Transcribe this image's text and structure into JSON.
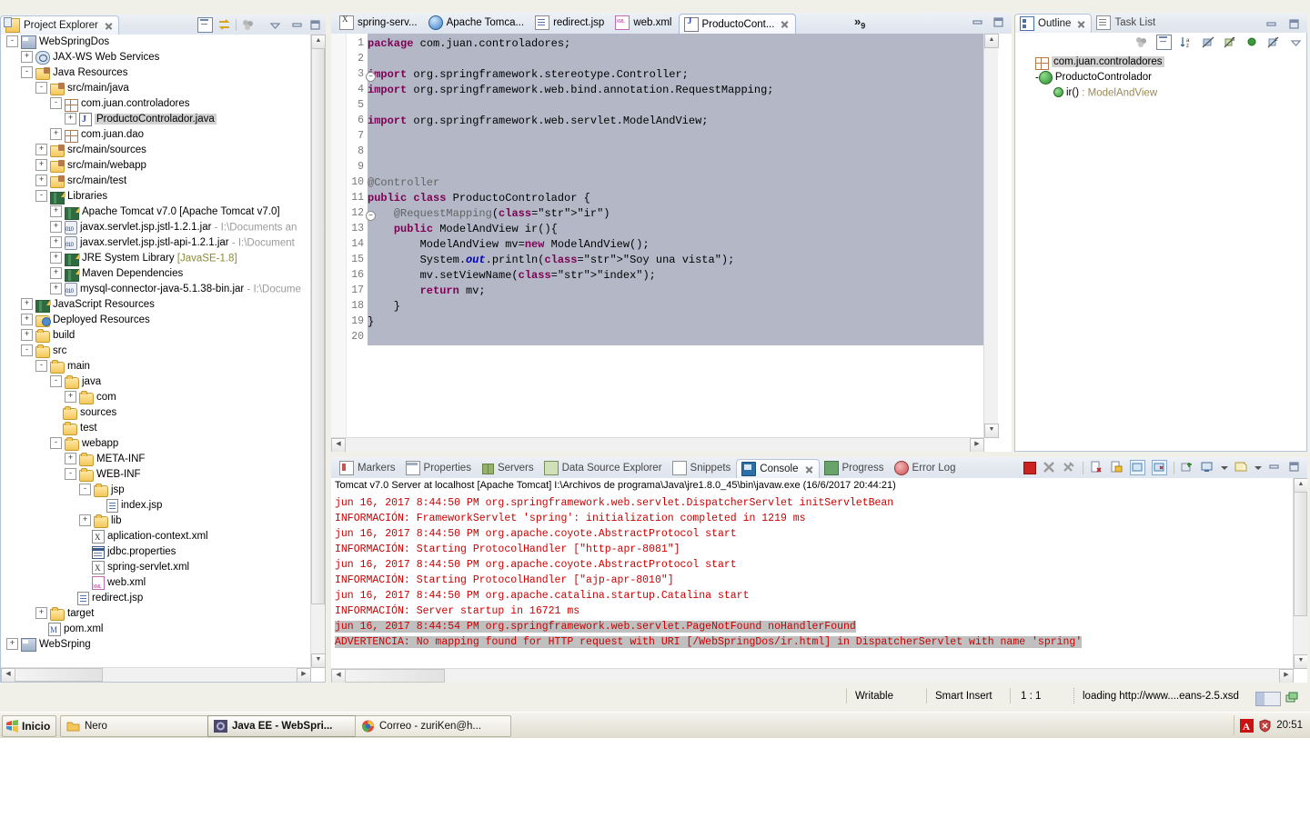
{
  "project_explorer": {
    "title": "Project Explorer",
    "toolbar_icons": [
      "collapse-all-icon",
      "link-with-editor-icon",
      "view-menu-dots-icon",
      "view-menu-chevron-icon",
      "minimize-icon",
      "maximize-icon"
    ],
    "tree": [
      {
        "depth": 0,
        "expander": "-",
        "icon": "project-icon",
        "label": "WebSpringDos"
      },
      {
        "depth": 1,
        "expander": "+",
        "icon": "webservices-icon",
        "label": "JAX-WS Web Services"
      },
      {
        "depth": 1,
        "expander": "-",
        "icon": "java-resources-icon",
        "label": "Java Resources"
      },
      {
        "depth": 2,
        "expander": "-",
        "icon": "source-folder-icon",
        "label": "src/main/java"
      },
      {
        "depth": 3,
        "expander": "-",
        "icon": "package-icon",
        "label": "com.juan.controladores"
      },
      {
        "depth": 4,
        "expander": "+",
        "icon": "java-file-icon",
        "label": "ProductoControlador.java",
        "selected": true
      },
      {
        "depth": 3,
        "expander": "+",
        "icon": "package-icon",
        "label": "com.juan.dao"
      },
      {
        "depth": 2,
        "expander": "+",
        "icon": "source-folder-icon",
        "label": "src/main/sources"
      },
      {
        "depth": 2,
        "expander": "+",
        "icon": "source-folder-icon",
        "label": "src/main/webapp"
      },
      {
        "depth": 2,
        "expander": "+",
        "icon": "source-folder-icon",
        "label": "src/main/test"
      },
      {
        "depth": 2,
        "expander": "-",
        "icon": "library-icon",
        "label": "Libraries"
      },
      {
        "depth": 3,
        "expander": "+",
        "icon": "library-icon",
        "label": "Apache Tomcat v7.0 [Apache Tomcat v7.0]"
      },
      {
        "depth": 3,
        "expander": "+",
        "icon": "jar-icon",
        "label": "javax.servlet.jsp.jstl-1.2.1.jar",
        "suffix": " - I:\\Documents an"
      },
      {
        "depth": 3,
        "expander": "+",
        "icon": "jar-icon",
        "label": "javax.servlet.jsp.jstl-api-1.2.1.jar",
        "suffix": " - I:\\Document"
      },
      {
        "depth": 3,
        "expander": "+",
        "icon": "library-icon",
        "label": "JRE System Library",
        "suffix": " [JavaSE-1.8]",
        "suffix_style": "green"
      },
      {
        "depth": 3,
        "expander": "+",
        "icon": "library-icon",
        "label": "Maven Dependencies"
      },
      {
        "depth": 3,
        "expander": "+",
        "icon": "jar-icon",
        "label": "mysql-connector-java-5.1.38-bin.jar",
        "suffix": " - I:\\Docume"
      },
      {
        "depth": 1,
        "expander": "+",
        "icon": "library-icon",
        "label": "JavaScript Resources"
      },
      {
        "depth": 1,
        "expander": "+",
        "icon": "deployed-resources-icon",
        "label": "Deployed Resources"
      },
      {
        "depth": 1,
        "expander": "+",
        "icon": "folder-icon",
        "label": "build"
      },
      {
        "depth": 1,
        "expander": "-",
        "icon": "folder-icon",
        "label": "src"
      },
      {
        "depth": 2,
        "expander": "-",
        "icon": "folder-icon",
        "label": "main"
      },
      {
        "depth": 3,
        "expander": "-",
        "icon": "folder-icon",
        "label": "java"
      },
      {
        "depth": 4,
        "expander": "+",
        "icon": "folder-icon",
        "label": "com"
      },
      {
        "depth": 3,
        "expander": "",
        "icon": "folder-icon",
        "label": "sources"
      },
      {
        "depth": 3,
        "expander": "",
        "icon": "folder-icon",
        "label": "test"
      },
      {
        "depth": 3,
        "expander": "-",
        "icon": "folder-icon",
        "label": "webapp"
      },
      {
        "depth": 4,
        "expander": "+",
        "icon": "folder-icon",
        "label": "META-INF"
      },
      {
        "depth": 4,
        "expander": "-",
        "icon": "folder-icon",
        "label": "WEB-INF"
      },
      {
        "depth": 5,
        "expander": "-",
        "icon": "folder-icon",
        "label": "jsp"
      },
      {
        "depth": 6,
        "expander": "",
        "icon": "jsp-file-icon",
        "label": "index.jsp"
      },
      {
        "depth": 5,
        "expander": "+",
        "icon": "folder-icon",
        "label": "lib"
      },
      {
        "depth": 5,
        "expander": "",
        "icon": "xml-file-icon",
        "label": "aplication-context.xml"
      },
      {
        "depth": 5,
        "expander": "",
        "icon": "properties-file-icon",
        "label": "jdbc.properties"
      },
      {
        "depth": 5,
        "expander": "",
        "icon": "xml-file-icon",
        "label": "spring-servlet.xml"
      },
      {
        "depth": 5,
        "expander": "",
        "icon": "web-xml-icon",
        "label": "web.xml"
      },
      {
        "depth": 4,
        "expander": "",
        "icon": "jsp-file-icon",
        "label": "redirect.jsp"
      },
      {
        "depth": 2,
        "expander": "+",
        "icon": "folder-icon",
        "label": "target"
      },
      {
        "depth": 2,
        "expander": "",
        "icon": "pom-icon",
        "label": "pom.xml"
      },
      {
        "depth": 0,
        "expander": "+",
        "icon": "project-icon",
        "label": "WebSrping"
      }
    ]
  },
  "editor": {
    "tabs": [
      {
        "label": "spring-serv...",
        "icon": "xml-file-icon",
        "active": false
      },
      {
        "label": "Apache Tomca...",
        "icon": "globe-icon",
        "active": false
      },
      {
        "label": "redirect.jsp",
        "icon": "jsp-file-icon",
        "active": false
      },
      {
        "label": "web.xml",
        "icon": "web-xml-icon",
        "active": false
      },
      {
        "label": "ProductoCont...",
        "icon": "java-file-icon",
        "active": true
      }
    ],
    "overflow_label": "»",
    "overflow_count": "9",
    "window_icons": [
      "minimize-icon",
      "maximize-icon"
    ],
    "line_numbers": [
      "1",
      "2",
      "3",
      "4",
      "5",
      "6",
      "7",
      "8",
      "9",
      "10",
      "11",
      "12",
      "13",
      "14",
      "15",
      "16",
      "17",
      "18",
      "19",
      "20"
    ],
    "code_lines": [
      "package com.juan.controladores;",
      "",
      "import org.springframework.stereotype.Controller;",
      "import org.springframework.web.bind.annotation.RequestMapping;",
      "",
      "import org.springframework.web.servlet.ModelAndView;",
      "",
      "",
      "",
      "@Controller",
      "public class ProductoControlador {",
      "    @RequestMapping(\"ir\")",
      "    public ModelAndView ir(){",
      "        ModelAndView mv=new ModelAndView();",
      "        System.out.println(\"Soy una vista\");",
      "        mv.setViewName(\"index\");",
      "        return mv;",
      "    }",
      "}",
      ""
    ],
    "folding_lines": [
      "3",
      "12"
    ]
  },
  "outline": {
    "tabs": [
      {
        "label": "Outline",
        "icon": "outline-icon",
        "active": true
      },
      {
        "label": "Task List",
        "icon": "task-list-icon",
        "active": false
      }
    ],
    "toolbar_icons": [
      "focus-icon",
      "collapse-all-icon",
      "sort-alpha-icon",
      "hide-fields-icon",
      "hide-static-icon",
      "public-members-icon",
      "hide-local-icon",
      "view-menu-icon"
    ],
    "window_icons": [
      "minimize-icon",
      "maximize-icon"
    ],
    "rows": [
      {
        "depth": 0,
        "expander": "",
        "icon": "package-icon",
        "label": "com.juan.controladores",
        "selected": true
      },
      {
        "depth": 0,
        "expander": "-",
        "icon": "class-icon",
        "label": "ProductoControlador"
      },
      {
        "depth": 1,
        "expander": "",
        "icon": "method-icon",
        "label": "ir()",
        "type": " : ModelAndView"
      }
    ]
  },
  "console": {
    "tabs": [
      {
        "label": "Markers",
        "icon": "markers-icon",
        "active": false
      },
      {
        "label": "Properties",
        "icon": "properties-icon",
        "active": false
      },
      {
        "label": "Servers",
        "icon": "servers-icon",
        "active": false
      },
      {
        "label": "Data Source Explorer",
        "icon": "data-source-explorer-icon",
        "active": false
      },
      {
        "label": "Snippets",
        "icon": "snippets-icon",
        "active": false
      },
      {
        "label": "Console",
        "icon": "console-icon",
        "active": true
      },
      {
        "label": "Progress",
        "icon": "progress-icon",
        "active": false
      },
      {
        "label": "Error Log",
        "icon": "error-log-icon",
        "active": false
      }
    ],
    "toolbar_icons": [
      "terminate-icon",
      "remove-launch-icon",
      "remove-all-terminated-icon",
      "clear-console-icon",
      "scroll-lock-icon",
      "word-wrap-icon",
      "pin-console-icon",
      "new-console-view-icon",
      "display-selected-console-icon",
      "open-console-icon",
      "minimize-icon",
      "maximize-icon"
    ],
    "header": "Tomcat v7.0 Server at localhost [Apache Tomcat] I:\\Archivos de programa\\Java\\jre1.8.0_45\\bin\\javaw.exe (16/6/2017 20:44:21)",
    "lines": [
      {
        "text": "jun 16, 2017 8:44:50 PM org.springframework.web.servlet.DispatcherServlet initServletBean",
        "highlight": false
      },
      {
        "text": "INFORMACIÓN: FrameworkServlet 'spring': initialization completed in 1219 ms",
        "highlight": false
      },
      {
        "text": "jun 16, 2017 8:44:50 PM org.apache.coyote.AbstractProtocol start",
        "highlight": false
      },
      {
        "text": "INFORMACIÓN: Starting ProtocolHandler [\"http-apr-8081\"]",
        "highlight": false
      },
      {
        "text": "jun 16, 2017 8:44:50 PM org.apache.coyote.AbstractProtocol start",
        "highlight": false
      },
      {
        "text": "INFORMACIÓN: Starting ProtocolHandler [\"ajp-apr-8010\"]",
        "highlight": false
      },
      {
        "text": "jun 16, 2017 8:44:50 PM org.apache.catalina.startup.Catalina start",
        "highlight": false
      },
      {
        "text": "INFORMACIÓN: Server startup in 16721 ms",
        "highlight": false
      },
      {
        "text": "jun 16, 2017 8:44:54 PM org.springframework.web.servlet.PageNotFound noHandlerFound",
        "highlight": true
      },
      {
        "text": "ADVERTENCIA: No mapping found for HTTP request with URI [/WebSpringDos/ir.html] in DispatcherServlet with name 'spring'",
        "highlight": true
      }
    ]
  },
  "status_bar": {
    "writable": "Writable",
    "insert_mode": "Smart Insert",
    "position": "1 : 1",
    "progress_text": "loading http://www....eans-2.5.xsd",
    "progress_icon": "progress-bar-icon",
    "network_icon": "network-activity-icon"
  },
  "taskbar": {
    "start_label": "Inicio",
    "start_icon": "windows-flag-icon",
    "buttons": [
      {
        "label": "Nero",
        "icon": "folder-icon",
        "active": false
      },
      {
        "label": "Java EE - WebSpri...",
        "icon": "eclipse-icon",
        "active": true
      },
      {
        "label": "Correo - zuriKen@h...",
        "icon": "chrome-icon",
        "active": false
      }
    ],
    "tray_icons": [
      "adobe-icon",
      "antivirus-shield-icon"
    ],
    "clock": "20:51"
  },
  "colors": {
    "keyword": "#7f0055",
    "string": "#2a00ff",
    "console_text": "#cc0000",
    "selection": "#b3b7c6",
    "tree_selection": "#d2d2d2"
  }
}
